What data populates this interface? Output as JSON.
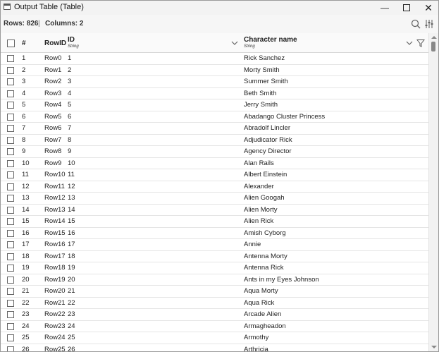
{
  "window": {
    "title": "Output Table (Table)",
    "minimize_glyph": "—",
    "close_glyph": "✕"
  },
  "toolbar": {
    "rows_label": "Rows: 826",
    "separator": "|",
    "columns_label": "Columns: 2",
    "icons": [
      "search-icon",
      "column-settings-icon"
    ]
  },
  "columns": {
    "index": {
      "name": "#"
    },
    "rowid": {
      "name": "RowID"
    },
    "id": {
      "name": "ID",
      "type": "String"
    },
    "character": {
      "name": "Character name",
      "type": "String"
    }
  },
  "rows": [
    {
      "n": "1",
      "rid": "Row0",
      "id": "1",
      "name": "Rick Sanchez"
    },
    {
      "n": "2",
      "rid": "Row1",
      "id": "2",
      "name": "Morty Smith"
    },
    {
      "n": "3",
      "rid": "Row2",
      "id": "3",
      "name": "Summer Smith"
    },
    {
      "n": "4",
      "rid": "Row3",
      "id": "4",
      "name": "Beth Smith"
    },
    {
      "n": "5",
      "rid": "Row4",
      "id": "5",
      "name": "Jerry Smith"
    },
    {
      "n": "6",
      "rid": "Row5",
      "id": "6",
      "name": "Abadango Cluster Princess"
    },
    {
      "n": "7",
      "rid": "Row6",
      "id": "7",
      "name": "Abradolf Lincler"
    },
    {
      "n": "8",
      "rid": "Row7",
      "id": "8",
      "name": "Adjudicator Rick"
    },
    {
      "n": "9",
      "rid": "Row8",
      "id": "9",
      "name": "Agency Director"
    },
    {
      "n": "10",
      "rid": "Row9",
      "id": "10",
      "name": "Alan Rails"
    },
    {
      "n": "11",
      "rid": "Row10",
      "id": "11",
      "name": "Albert Einstein"
    },
    {
      "n": "12",
      "rid": "Row11",
      "id": "12",
      "name": "Alexander"
    },
    {
      "n": "13",
      "rid": "Row12",
      "id": "13",
      "name": "Alien Googah"
    },
    {
      "n": "14",
      "rid": "Row13",
      "id": "14",
      "name": "Alien Morty"
    },
    {
      "n": "15",
      "rid": "Row14",
      "id": "15",
      "name": "Alien Rick"
    },
    {
      "n": "16",
      "rid": "Row15",
      "id": "16",
      "name": "Amish Cyborg"
    },
    {
      "n": "17",
      "rid": "Row16",
      "id": "17",
      "name": "Annie"
    },
    {
      "n": "18",
      "rid": "Row17",
      "id": "18",
      "name": "Antenna Morty"
    },
    {
      "n": "19",
      "rid": "Row18",
      "id": "19",
      "name": "Antenna Rick"
    },
    {
      "n": "20",
      "rid": "Row19",
      "id": "20",
      "name": "Ants in my Eyes Johnson"
    },
    {
      "n": "21",
      "rid": "Row20",
      "id": "21",
      "name": "Aqua Morty"
    },
    {
      "n": "22",
      "rid": "Row21",
      "id": "22",
      "name": "Aqua Rick"
    },
    {
      "n": "23",
      "rid": "Row22",
      "id": "23",
      "name": "Arcade Alien"
    },
    {
      "n": "24",
      "rid": "Row23",
      "id": "24",
      "name": "Armagheadon"
    },
    {
      "n": "25",
      "rid": "Row24",
      "id": "25",
      "name": "Armothy"
    },
    {
      "n": "26",
      "rid": "Row25",
      "id": "26",
      "name": "Arthricia"
    }
  ]
}
